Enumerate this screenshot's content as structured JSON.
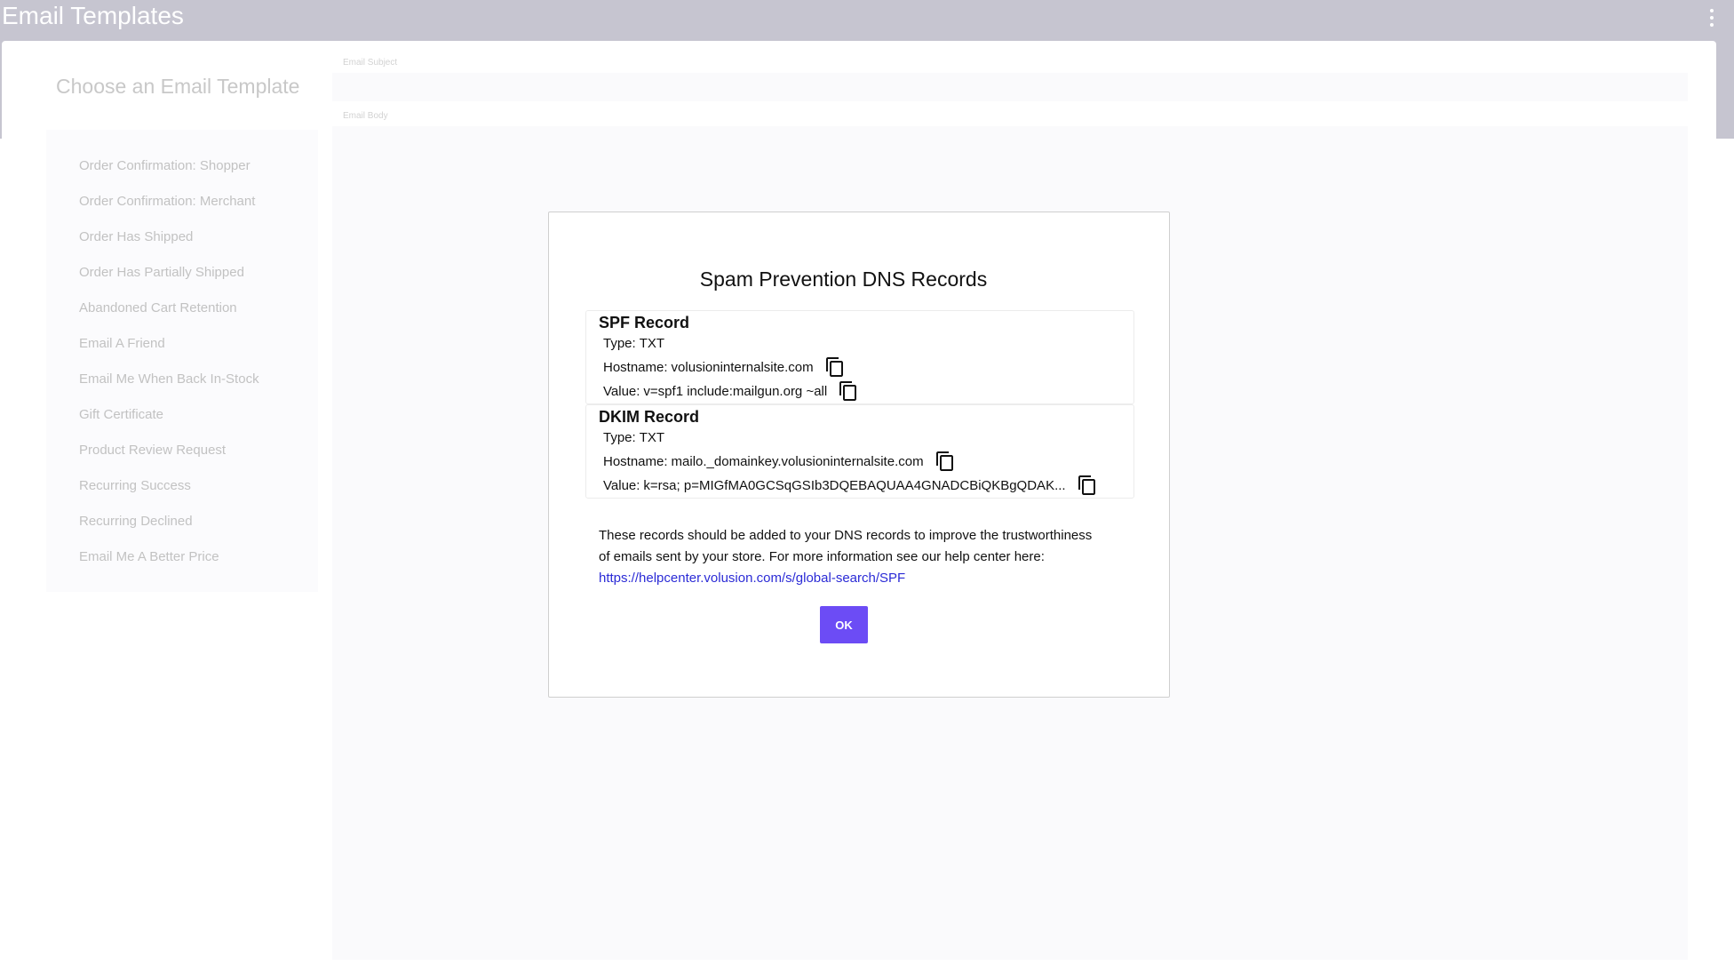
{
  "app": {
    "title": "Email Templates",
    "menu_icon": "more-vert-icon"
  },
  "sidebar": {
    "heading": "Choose an Email Template",
    "items": [
      {
        "label": "Order Confirmation: Shopper"
      },
      {
        "label": "Order Confirmation: Merchant"
      },
      {
        "label": "Order Has Shipped"
      },
      {
        "label": "Order Has Partially Shipped"
      },
      {
        "label": "Abandoned Cart Retention"
      },
      {
        "label": "Email A Friend"
      },
      {
        "label": "Email Me When Back In-Stock"
      },
      {
        "label": "Gift Certificate"
      },
      {
        "label": "Product Review Request"
      },
      {
        "label": "Recurring Success"
      },
      {
        "label": "Recurring Declined"
      },
      {
        "label": "Email Me A Better Price"
      }
    ]
  },
  "editor": {
    "subject_label": "Email Subject",
    "body_label": "Email Body"
  },
  "modal": {
    "title": "Spam Prevention DNS Records",
    "spf": {
      "title": "SPF Record",
      "type_label": "Type:",
      "type_value": "TXT",
      "hostname_label": "Hostname:",
      "hostname_value": "volusioninternalsite.com",
      "value_label": "Value:",
      "value_value": "v=spf1 include:mailgun.org ~all"
    },
    "dkim": {
      "title": "DKIM Record",
      "type_label": "Type:",
      "type_value": "TXT",
      "hostname_label": "Hostname:",
      "hostname_value": "mailo._domainkey.volusioninternalsite.com",
      "value_label": "Value:",
      "value_value": "k=rsa; p=MIGfMA0GCSqGSIb3DQEBAQUAA4GNADCBiQKBgQDAK..."
    },
    "note_text": "These records should be added to your DNS records to improve the trustworthiness of emails sent by your store. For more information see our help center here:",
    "help_link": "https://helpcenter.volusion.com/s/global-search/SPF",
    "ok_label": "OK",
    "copy_icon": "copy-icon"
  },
  "colors": {
    "topbar": "#c6c5d0",
    "accent": "#6c4cf5",
    "link": "#2b2bd6"
  }
}
